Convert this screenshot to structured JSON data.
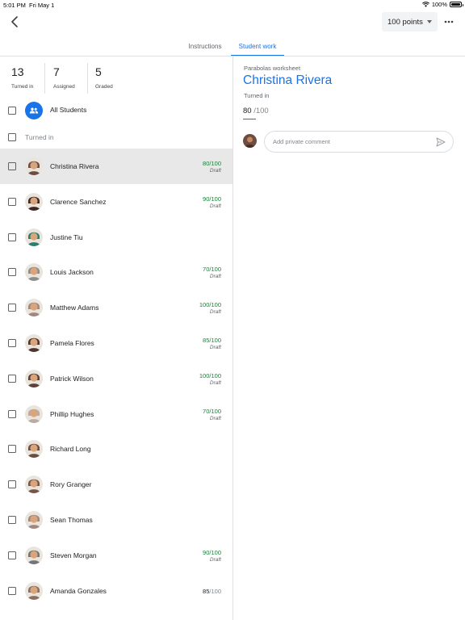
{
  "status_bar": {
    "time": "5:01 PM",
    "date": "Fri May 1",
    "battery": "100%"
  },
  "header": {
    "points": "100 points"
  },
  "tabs": [
    {
      "label": "Instructions"
    },
    {
      "label": "Student work"
    }
  ],
  "stats": [
    {
      "value": "13",
      "label": "Turned in"
    },
    {
      "value": "7",
      "label": "Assigned"
    },
    {
      "value": "5",
      "label": "Graded"
    }
  ],
  "all_students_label": "All Students",
  "turned_in_section_label": "Turned in",
  "students": [
    {
      "name": "Christina Rivera",
      "grade": "80/100",
      "state": "Draft",
      "selected": true,
      "avatar_color": "#6d4c41"
    },
    {
      "name": "Clarence Sanchez",
      "grade": "90/100",
      "state": "Draft",
      "avatar_color": "#3e2723"
    },
    {
      "name": "Justine Tiu",
      "grade": "",
      "state": "",
      "avatar_color": "#2e7d6b"
    },
    {
      "name": "Louis Jackson",
      "grade": "70/100",
      "state": "Draft",
      "avatar_color": "#8d8d8d"
    },
    {
      "name": "Matthew Adams",
      "grade": "100/100",
      "state": "Draft",
      "avatar_color": "#a1887f"
    },
    {
      "name": "Pamela Flores",
      "grade": "85/100",
      "state": "Draft",
      "avatar_color": "#4e342e"
    },
    {
      "name": "Patrick Wilson",
      "grade": "100/100",
      "state": "Draft",
      "avatar_color": "#5d4037"
    },
    {
      "name": "Phillip Hughes",
      "grade": "70/100",
      "state": "Draft",
      "avatar_color": "#bcaaa4"
    },
    {
      "name": "Richard Long",
      "grade": "",
      "state": "",
      "avatar_color": "#6d4c41"
    },
    {
      "name": "Rory Granger",
      "grade": "",
      "state": "",
      "avatar_color": "#795548"
    },
    {
      "name": "Sean Thomas",
      "grade": "",
      "state": "",
      "avatar_color": "#a1887f"
    },
    {
      "name": "Steven Morgan",
      "grade": "90/100",
      "state": "Draft",
      "avatar_color": "#757575"
    },
    {
      "name": "Amanda Gonzales",
      "grade_value": "85",
      "grade_denominator": "/100",
      "final": true,
      "avatar_color": "#8d6e63"
    }
  ],
  "detail": {
    "assignment": "Parabolas worksheet",
    "student": "Christina Rivera",
    "status": "Turned in",
    "grade": "80",
    "grade_denominator": "/100",
    "comment_placeholder": "Add private comment"
  },
  "colors": {
    "accent": "#1a73e8",
    "grade_green": "#188038",
    "selected_row": "#e8e8e8"
  },
  "icons": [
    "back-arrow-icon",
    "dropdown-caret-icon",
    "more-icon",
    "group-icon",
    "send-icon",
    "wifi-icon",
    "battery-icon"
  ]
}
